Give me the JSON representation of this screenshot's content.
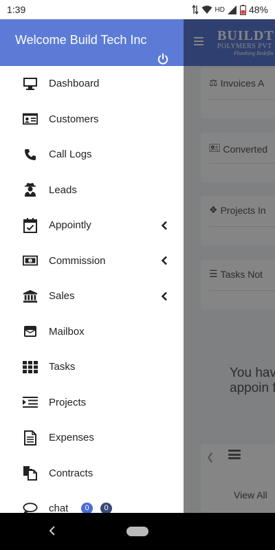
{
  "status_bar": {
    "time": "1:39",
    "network": "HD",
    "battery": "48%"
  },
  "app": {
    "logo": {
      "line1": "BUILDT",
      "line2": "POLYMERS PVT",
      "line3": "Plumbing Redefin"
    },
    "cards": [
      {
        "title": "Invoices A",
        "icon": "scale-icon"
      },
      {
        "title": "Converted",
        "icon": "money-icon"
      },
      {
        "title": "Projects In",
        "icon": "cubes-icon"
      },
      {
        "title": "Tasks Not",
        "icon": "list-icon"
      }
    ],
    "empty_message": "You hav appoin for tod",
    "view_all": "View All"
  },
  "drawer": {
    "title": "Welcome Build Tech Inc",
    "menu": [
      {
        "label": "Dashboard",
        "icon": "monitor-icon",
        "has_submenu": false
      },
      {
        "label": "Customers",
        "icon": "id-card-icon",
        "has_submenu": false
      },
      {
        "label": "Call Logs",
        "icon": "phone-icon",
        "has_submenu": false
      },
      {
        "label": "Leads",
        "icon": "user-secret-icon",
        "has_submenu": false
      },
      {
        "label": "Appointly",
        "icon": "calendar-check-icon",
        "has_submenu": true
      },
      {
        "label": "Commission",
        "icon": "money-bill-icon",
        "has_submenu": true
      },
      {
        "label": "Sales",
        "icon": "bank-icon",
        "has_submenu": true
      },
      {
        "label": "Mailbox",
        "icon": "envelope-icon",
        "has_submenu": false
      },
      {
        "label": "Tasks",
        "icon": "grid-icon",
        "has_submenu": false
      },
      {
        "label": "Projects",
        "icon": "indent-list-icon",
        "has_submenu": false
      },
      {
        "label": "Expenses",
        "icon": "document-icon",
        "has_submenu": false
      },
      {
        "label": "Contracts",
        "icon": "files-icon",
        "has_submenu": false
      },
      {
        "label": "chat",
        "icon": "chat-bubble-icon",
        "has_submenu": false,
        "badges": [
          "0",
          "0"
        ]
      }
    ]
  },
  "colors": {
    "primary": "#5b7bd6",
    "badge_primary": "#4c6bd6",
    "badge_secondary": "#3c4a78"
  }
}
